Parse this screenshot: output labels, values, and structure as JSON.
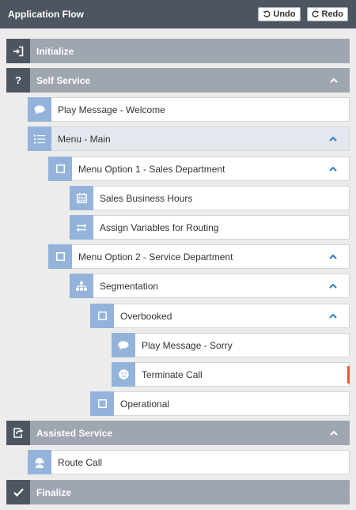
{
  "header": {
    "title": "Application Flow",
    "undo_label": "Undo",
    "redo_label": "Redo"
  },
  "flow": {
    "initialize": "Initialize",
    "self_service": "Self Service",
    "play_welcome": "Play Message - Welcome",
    "menu_main": "Menu - Main",
    "menu_option_1": "Menu Option 1 - Sales Department",
    "sales_business_hours": "Sales Business Hours",
    "assign_variables": "Assign Variables for Routing",
    "menu_option_2": "Menu Option 2 - Service Department",
    "segmentation": "Segmentation",
    "overbooked": "Overbooked",
    "play_sorry": "Play Message - Sorry",
    "terminate_call": "Terminate Call",
    "operational": "Operational",
    "assisted_service": "Assisted Service",
    "route_call": "Route Call",
    "finalize": "Finalize"
  },
  "colors": {
    "header": "#4d5560",
    "section": "#9fa6b0",
    "item_icon": "#93b3da",
    "chevron": "#2d7fc8",
    "error_marker": "#e05a3c"
  }
}
